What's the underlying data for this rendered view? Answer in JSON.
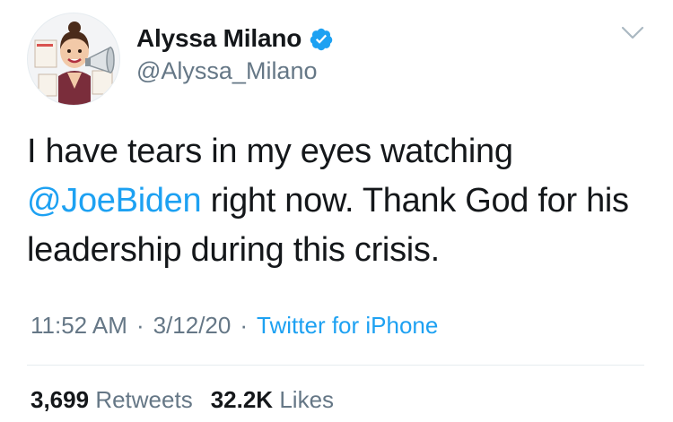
{
  "author": {
    "display_name": "Alyssa Milano",
    "handle": "@Alyssa_Milano",
    "verified": true,
    "avatar_icon": "caricature-avatar-icon"
  },
  "header": {
    "menu_icon": "chevron-down-icon"
  },
  "tweet": {
    "text_before": "I have tears in my eyes watching ",
    "mention": "@JoeBiden",
    "text_after": " right now. Thank God for his leadership during this crisis."
  },
  "meta": {
    "time": "11:52 AM",
    "date": "3/12/20",
    "source": "Twitter for iPhone",
    "separator": "·"
  },
  "stats": {
    "retweets_count": "3,699",
    "retweets_label": "Retweets",
    "likes_count": "32.2K",
    "likes_label": "Likes"
  },
  "colors": {
    "link": "#1da1f2",
    "secondary_text": "#657786",
    "primary_text": "#14171a",
    "divider": "#e6ecf0"
  }
}
